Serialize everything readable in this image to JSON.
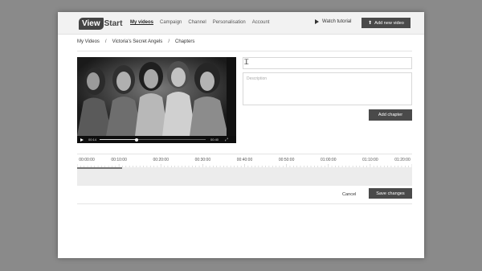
{
  "header": {
    "logo_left": "View",
    "logo_right": "Start",
    "nav": [
      {
        "label": "My videos",
        "active": true
      },
      {
        "label": "Campaign",
        "active": false
      },
      {
        "label": "Channel",
        "active": false
      },
      {
        "label": "Personalisation",
        "active": false
      },
      {
        "label": "Account",
        "active": false
      }
    ],
    "watch_tutorial": "Watch tutorial",
    "add_video": "Add new video"
  },
  "breadcrumb": [
    "My Videos",
    "Victoria's Secret Angels",
    "Chapters"
  ],
  "video": {
    "current_time": "00:14",
    "duration": "00:40",
    "progress": 0.35
  },
  "form": {
    "title_value": "",
    "description_placeholder": "Description",
    "add_chapter": "Add chapter"
  },
  "timeline": {
    "labels": [
      "00:00:00",
      "00:10:00",
      "00:20:00",
      "00:30:00",
      "00:40:00",
      "00:50:00",
      "01:00:00",
      "01:10:00",
      "01:20:00"
    ],
    "progress": 0.135
  },
  "actions": {
    "cancel": "Cancel",
    "save": "Save changes"
  },
  "colors": {
    "button_bg": "#4a4a4a",
    "header_bg": "#f2f2f2",
    "track_bg": "#ececec"
  }
}
